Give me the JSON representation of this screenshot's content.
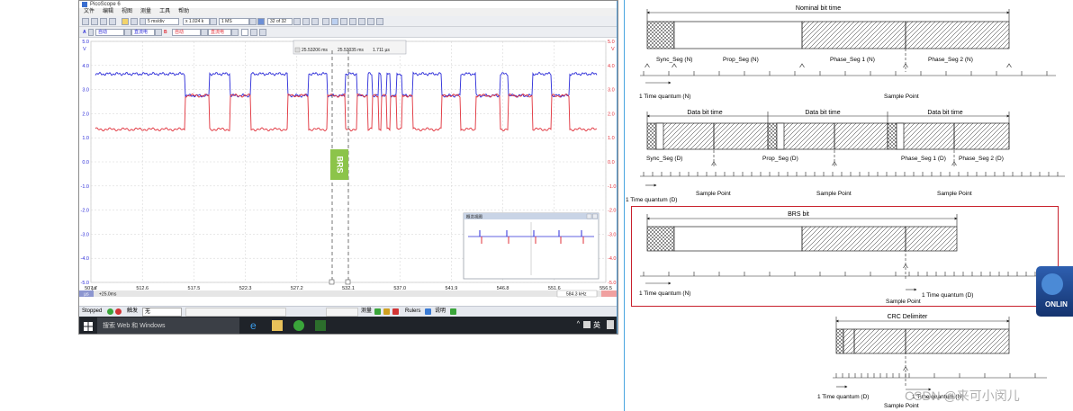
{
  "app": {
    "title": "PicoScope 6",
    "menu": [
      "文件",
      "编辑",
      "视图",
      "测量",
      "工具",
      "帮助"
    ],
    "logo": "pico",
    "logo_sub": "Technology"
  },
  "toolbar": {
    "timebase": "5 ms/div",
    "zoom": "x 1.024 k",
    "samples": "1 MS",
    "capture_count": "32 of 32",
    "chA": "A",
    "chA_coupling": "自动",
    "chA_range": "直流电",
    "chB": "B",
    "chB_coupling": "自动",
    "chB_range": "直流电"
  },
  "rulers": {
    "t1": "25.53206 ms",
    "t2": "25.53035 ms",
    "dt": "1.711 µs"
  },
  "scope": {
    "left_unit": "V",
    "right_unit": "V",
    "y_ticks_left": [
      "5.0",
      "4.0",
      "3.0",
      "2.0",
      "1.0",
      "0.0",
      "-1.0",
      "-2.0",
      "-3.0",
      "-4.0",
      "-5.0"
    ],
    "y_ticks_right": [
      "5.0",
      "4.0",
      "3.0",
      "2.0",
      "1.0",
      "0.0",
      "-1.0",
      "-2.0",
      "-3.0",
      "-4.0",
      "-5.0"
    ],
    "x_ticks": [
      "507.7",
      "512.6",
      "517.5",
      "522.3",
      "527.2",
      "532.1",
      "537.0",
      "541.9",
      "546.8",
      "551.6",
      "556.5"
    ],
    "x_unit": "µs",
    "x_offset": "+25.0ms",
    "annotation": "BRS",
    "freq_readout": "584.3 kHz",
    "overview_title": "概览视图",
    "colors": {
      "chA": "#2b2bd8",
      "chB": "#e0303a",
      "annotation": "#8cc44a"
    }
  },
  "statusbar": {
    "state": "Stopped",
    "trigger_label": "触发",
    "trigger_mode": "无",
    "measure_label": "测量",
    "rulers_label": "Rulers",
    "notes_label": "说明"
  },
  "taskbar": {
    "search_placeholder": "搜索 Web 和 Windows",
    "ime": "英"
  },
  "timing": {
    "diagram1": {
      "title": "Nominal bit time",
      "seg_labels": [
        "Sync_Seg (N)",
        "Prop_Seg (N)",
        "Phase_Seg 1 (N)",
        "Phase_Seg 2 (N)"
      ],
      "quantum_label": "1 Time quantum (N)",
      "sample_point": "Sample Point"
    },
    "diagram2": {
      "titles": [
        "Data bit time",
        "Data bit time",
        "Data bit time"
      ],
      "seg_labels": [
        "Sync_Seg (D)",
        "Prop_Seg (D)",
        "Phase_Seg 1 (D)",
        "Phase_Seg 2 (D)"
      ],
      "quantum_label": "1 Time quantum (D)",
      "sample_points": [
        "Sample Point",
        "Sample Point",
        "Sample Point"
      ]
    },
    "diagram3": {
      "title": "BRS bit",
      "quantum_n": "1 Time quantum (N)",
      "quantum_d": "1 Time quantum (D)",
      "sample_point": "Sample Point"
    },
    "diagram4": {
      "title": "CRC Delimiter",
      "quantum_d": "1 Time quantum (D)",
      "quantum_n": "1 Time quantum (N)",
      "sample_point": "Sample Point"
    }
  },
  "overlay": {
    "online_badge": "ONLIN",
    "watermark": "CSDN @来可小闵儿"
  }
}
